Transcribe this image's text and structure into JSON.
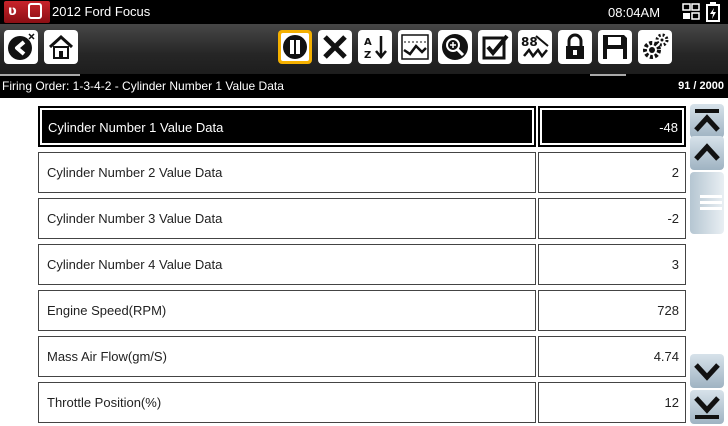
{
  "title_bar": {
    "vehicle": "2012 Ford Focus",
    "time": "08:04AM"
  },
  "toolbar": {
    "buttons": [
      {
        "icon": "back-icon"
      },
      {
        "icon": "home-icon"
      },
      {
        "icon": "pause-icon",
        "selected": true
      },
      {
        "icon": "close-icon"
      },
      {
        "icon": "sort-icon"
      },
      {
        "icon": "graph-view-icon"
      },
      {
        "icon": "zoom-icon"
      },
      {
        "icon": "checkbox-icon"
      },
      {
        "icon": "percent-graph-icon"
      },
      {
        "icon": "lock-icon"
      },
      {
        "icon": "save-icon"
      },
      {
        "icon": "settings-icon"
      }
    ]
  },
  "status": {
    "text": "Firing Order: 1-3-4-2 - Cylinder Number 1 Value Data",
    "counter": "91 / 2000"
  },
  "data_rows": [
    {
      "name": "Cylinder Number 1 Value Data",
      "value": "-48",
      "selected": true
    },
    {
      "name": "Cylinder Number 2 Value Data",
      "value": "2"
    },
    {
      "name": "Cylinder Number 3 Value Data",
      "value": "-2"
    },
    {
      "name": "Cylinder Number 4 Value Data",
      "value": "3"
    },
    {
      "name": "Engine Speed(RPM)",
      "value": "728"
    },
    {
      "name": "Mass Air Flow(gm/S)",
      "value": "4.74"
    },
    {
      "name": "Throttle Position(%)",
      "value": "12"
    }
  ],
  "scrollbar": {
    "buttons": [
      "page-up-icon",
      "line-up-icon",
      "line-down-icon",
      "page-down-icon"
    ]
  }
}
